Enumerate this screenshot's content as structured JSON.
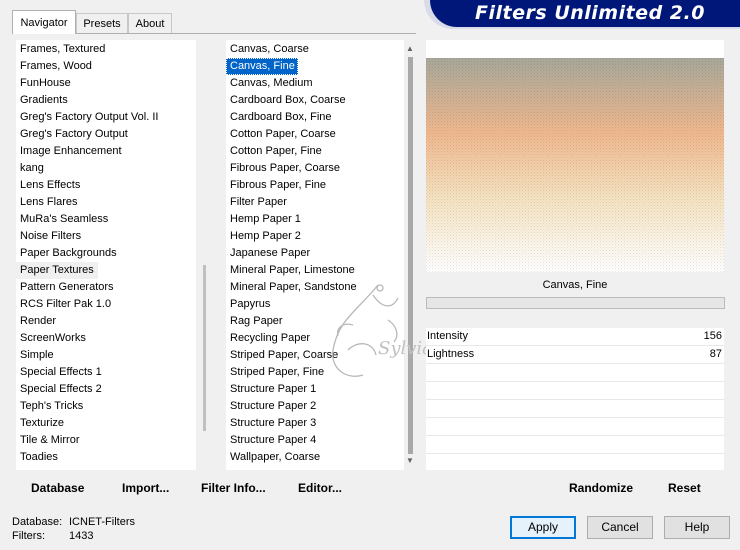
{
  "tabs": [
    {
      "label": "Navigator"
    },
    {
      "label": "Presets"
    },
    {
      "label": "About"
    }
  ],
  "banner": {
    "title": "Filters Unlimited 2.0"
  },
  "categories": [
    "Frames, Textured",
    "Frames, Wood",
    "FunHouse",
    "Gradients",
    "Greg's Factory Output Vol. II",
    "Greg's Factory Output",
    "Image Enhancement",
    "kang",
    "Lens Effects",
    "Lens Flares",
    "MuRa's Seamless",
    "Noise Filters",
    "Paper Backgrounds",
    "Paper Textures",
    "Pattern Generators",
    "RCS Filter Pak 1.0",
    "Render",
    "ScreenWorks",
    "Simple",
    "Special Effects 1",
    "Special Effects 2",
    "Teph's Tricks",
    "Texturize",
    "Tile & Mirror",
    "Toadies"
  ],
  "selected_category": "Paper Textures",
  "filters": [
    "Canvas, Coarse",
    "Canvas, Fine",
    "Canvas, Medium",
    "Cardboard Box, Coarse",
    "Cardboard Box, Fine",
    "Cotton Paper, Coarse",
    "Cotton Paper, Fine",
    "Fibrous Paper, Coarse",
    "Fibrous Paper, Fine",
    "Filter Paper",
    "Hemp Paper 1",
    "Hemp Paper 2",
    "Japanese Paper",
    "Mineral Paper, Limestone",
    "Mineral Paper, Sandstone",
    "Papyrus",
    "Rag Paper",
    "Recycling Paper",
    "Striped Paper, Coarse",
    "Striped Paper, Fine",
    "Structure Paper 1",
    "Structure Paper 2",
    "Structure Paper 3",
    "Structure Paper 4",
    "Wallpaper, Coarse"
  ],
  "selected_filter": "Canvas, Fine",
  "preview": {
    "label": "Canvas, Fine"
  },
  "params": [
    {
      "label": "Intensity",
      "value": "156"
    },
    {
      "label": "Lightness",
      "value": "87"
    }
  ],
  "toolbar": {
    "database": "Database",
    "import": "Import...",
    "filter_info": "Filter Info...",
    "editor": "Editor...",
    "randomize": "Randomize",
    "reset": "Reset"
  },
  "status": {
    "database_label": "Database:",
    "database_value": "ICNET-Filters",
    "filters_label": "Filters:",
    "filters_value": "1433"
  },
  "buttons": {
    "apply": "Apply",
    "cancel": "Cancel",
    "help": "Help"
  },
  "watermark": "Sylvia",
  "colors": {
    "banner": "#00177a",
    "selection": "#0064c8",
    "default_border": "#0078d7"
  }
}
